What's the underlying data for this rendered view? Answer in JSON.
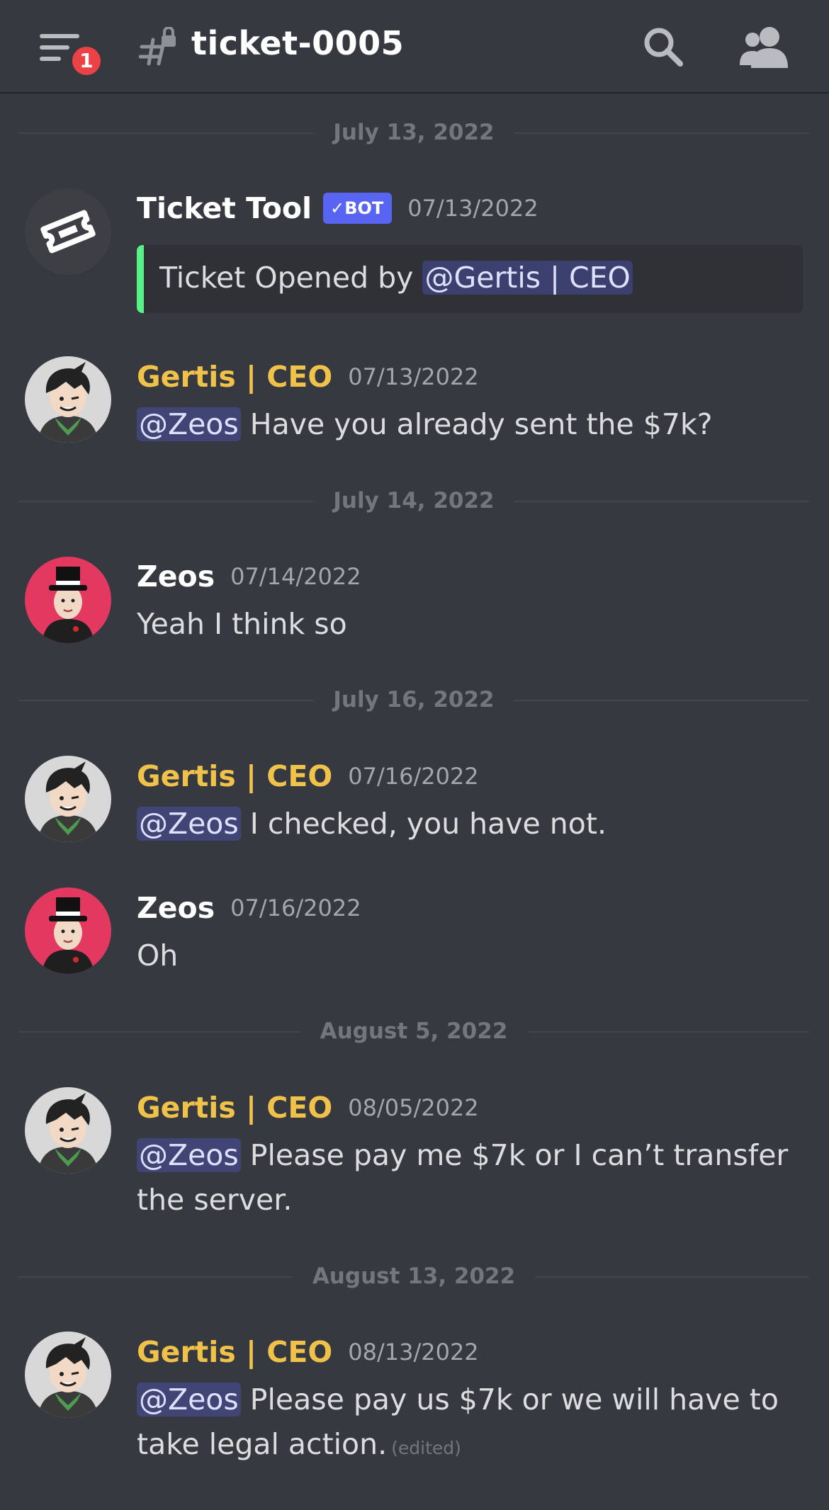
{
  "header": {
    "notification_count": "1",
    "channel_name": "ticket-0005"
  },
  "dividers": [
    "July 13, 2022",
    "July 14, 2022",
    "July 16, 2022",
    "August 5, 2022",
    "August 13, 2022"
  ],
  "messages": [
    {
      "author": "Ticket Tool",
      "tag": "BOT",
      "time": "07/13/2022",
      "embed_prefix": "Ticket Opened by ",
      "embed_mention": "@Gertis | CEO"
    },
    {
      "author": "Gertis | CEO",
      "time": "07/13/2022",
      "mention": "@Zeos",
      "text": " Have you already sent the $7k?"
    },
    {
      "author": "Zeos",
      "time": "07/14/2022",
      "text": "Yeah I think so"
    },
    {
      "author": "Gertis | CEO",
      "time": "07/16/2022",
      "mention": "@Zeos",
      "text": " I checked, you have not."
    },
    {
      "author": "Zeos",
      "time": "07/16/2022",
      "text": "Oh"
    },
    {
      "author": "Gertis | CEO",
      "time": "08/05/2022",
      "mention": "@Zeos",
      "text": " Please pay me $7k or I can’t transfer the server."
    },
    {
      "author": "Gertis | CEO",
      "time": "08/13/2022",
      "mention": "@Zeos",
      "text": " Please pay us $7k or we will have to take legal action.",
      "edited": "(edited)"
    }
  ],
  "colors": {
    "background": "#36393f",
    "gertis_name": "#f0c24a",
    "zeos_name": "#ffffff",
    "bot_tag": "#5865f2",
    "embed_accent": "#57f287",
    "badge": "#ed4245"
  },
  "icons": {
    "menu": "menu-icon",
    "channel": "locked-hash-icon",
    "search": "search-icon",
    "members": "members-icon",
    "ticket": "ticket-icon"
  }
}
